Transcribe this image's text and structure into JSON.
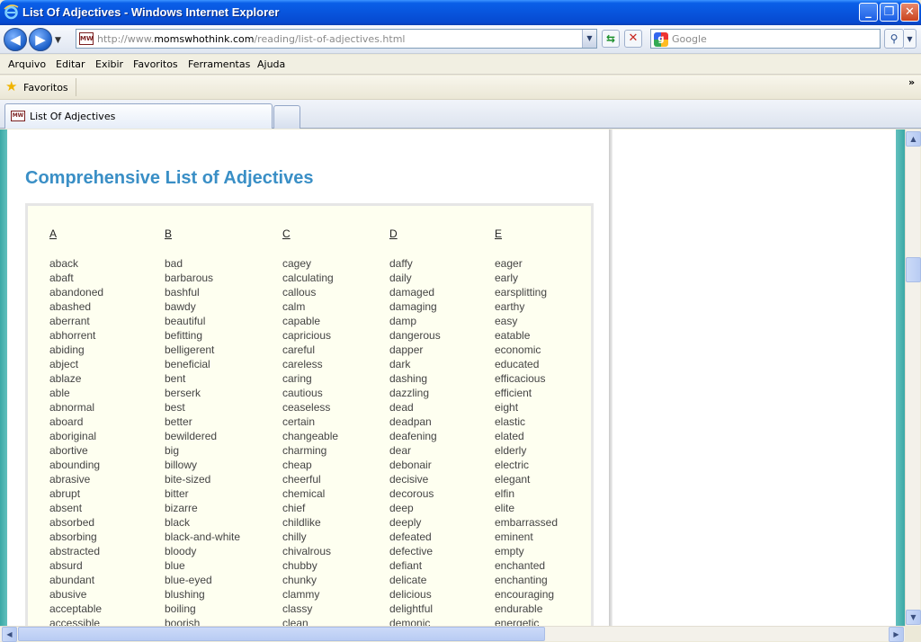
{
  "window": {
    "title": "List Of Adjectives - Windows Internet Explorer",
    "minimize_glyph": "_",
    "maximize_glyph": "❐",
    "close_glyph": "✕"
  },
  "nav": {
    "back_glyph": "◀",
    "forward_glyph": "▶",
    "dropdown_glyph": "▼",
    "url_prefix": "http://www.",
    "url_domain": "momswhothink.com",
    "url_path": "/reading/list-of-adjectives.html",
    "site_icon_text": "MW",
    "refresh_glyph": "⇆",
    "stop_glyph": "✕",
    "search_placeholder": "Google",
    "search_glyph": "⚲"
  },
  "menu": [
    "Arquivo",
    "Editar",
    "Exibir",
    "Favoritos",
    "Ferramentas",
    "Ajuda"
  ],
  "favorites": {
    "label": "Favoritos",
    "more_glyph": "»"
  },
  "tab": {
    "label": "List Of Adjectives",
    "icon_text": "MW"
  },
  "page": {
    "heading": "Comprehensive List of Adjectives",
    "columns": [
      {
        "letter": "A",
        "words": [
          "aback",
          "abaft",
          "abandoned",
          "abashed",
          "aberrant",
          "abhorrent",
          "abiding",
          "abject",
          "ablaze",
          "able",
          "abnormal",
          "aboard",
          "aboriginal",
          "abortive",
          "abounding",
          "abrasive",
          "abrupt",
          "absent",
          "absorbed",
          "absorbing",
          "abstracted",
          "absurd",
          "abundant",
          "abusive",
          "acceptable",
          "accessible"
        ]
      },
      {
        "letter": "B",
        "words": [
          "bad",
          "barbarous",
          "bashful",
          "bawdy",
          "beautiful",
          "befitting",
          "belligerent",
          "beneficial",
          "bent",
          "berserk",
          "best",
          "better",
          "bewildered",
          "big",
          "billowy",
          "bite-sized",
          "bitter",
          "bizarre",
          "black",
          "black-and-white",
          "bloody",
          "blue",
          "blue-eyed",
          "blushing",
          "boiling",
          "boorish"
        ]
      },
      {
        "letter": "C",
        "words": [
          "cagey",
          "calculating",
          "callous",
          "calm",
          "capable",
          "capricious",
          "careful",
          "careless",
          "caring",
          "cautious",
          "ceaseless",
          "certain",
          "changeable",
          "charming",
          "cheap",
          "cheerful",
          "chemical",
          "chief",
          "childlike",
          "chilly",
          "chivalrous",
          "chubby",
          "chunky",
          "clammy",
          "classy",
          "clean"
        ]
      },
      {
        "letter": "D",
        "words": [
          "daffy",
          "daily",
          "damaged",
          "damaging",
          "damp",
          "dangerous",
          "dapper",
          "dark",
          "dashing",
          "dazzling",
          "dead",
          "deadpan",
          "deafening",
          "dear",
          "debonair",
          "decisive",
          "decorous",
          "deep",
          "deeply",
          "defeated",
          "defective",
          "defiant",
          "delicate",
          "delicious",
          "delightful",
          "demonic"
        ]
      },
      {
        "letter": "E",
        "words": [
          "eager",
          "early",
          "earsplitting",
          "earthy",
          "easy",
          "eatable",
          "economic",
          "educated",
          "efficacious",
          "efficient",
          "eight",
          "elastic",
          "elated",
          "elderly",
          "electric",
          "elegant",
          "elfin",
          "elite",
          "embarrassed",
          "eminent",
          "empty",
          "enchanted",
          "enchanting",
          "encouraging",
          "endurable",
          "energetic"
        ]
      }
    ]
  },
  "scrollbar": {
    "up_glyph": "▲",
    "down_glyph": "▼",
    "left_glyph": "◀",
    "right_glyph": "▶"
  }
}
